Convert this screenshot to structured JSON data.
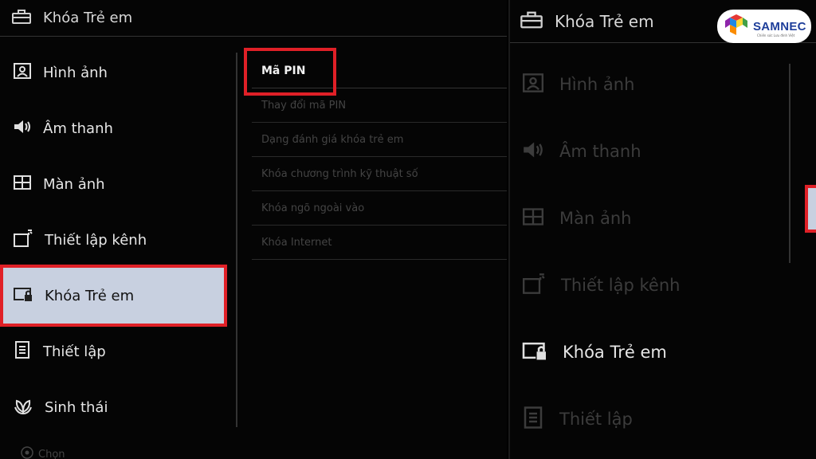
{
  "left_panel": {
    "header": {
      "title": "Khóa Trẻ em",
      "icon": "toolbox-icon"
    },
    "menu": [
      {
        "label": "Hình ảnh",
        "icon": "picture-icon",
        "state": "normal"
      },
      {
        "label": "Âm thanh",
        "icon": "speaker-icon",
        "state": "normal"
      },
      {
        "label": "Màn ảnh",
        "icon": "screen-icon",
        "state": "normal"
      },
      {
        "label": "Thiết lập kênh",
        "icon": "channel-setup-icon",
        "state": "normal"
      },
      {
        "label": "Khóa Trẻ em",
        "icon": "parental-lock-icon",
        "state": "selected"
      },
      {
        "label": "Thiết lập",
        "icon": "settings-icon",
        "state": "normal"
      },
      {
        "label": "Sinh thái",
        "icon": "eco-icon",
        "state": "normal"
      }
    ],
    "submenu": [
      "Mã PIN",
      "Thay đổi mã PIN",
      "Dạng đánh giá khóa trẻ em",
      "Khóa chương trình kỹ thuật số",
      "Khóa ngõ ngoài vào",
      "Khóa Internet"
    ],
    "footer": {
      "icon": "dpad-icon",
      "label": "Chọn"
    }
  },
  "right_panel": {
    "header": {
      "title": "Khóa Trẻ em",
      "icon": "toolbox-icon"
    },
    "menu": [
      {
        "label": "Hình ảnh",
        "icon": "picture-icon",
        "state": "dim"
      },
      {
        "label": "Âm thanh",
        "icon": "speaker-icon",
        "state": "dim"
      },
      {
        "label": "Màn ảnh",
        "icon": "screen-icon",
        "state": "dim"
      },
      {
        "label": "Thiết lập kênh",
        "icon": "channel-setup-icon",
        "state": "dim"
      },
      {
        "label": "Khóa Trẻ em",
        "icon": "parental-lock-icon",
        "state": "active"
      },
      {
        "label": "Thiết lập",
        "icon": "settings-icon",
        "state": "dim"
      }
    ]
  },
  "logo": {
    "brand": "SAMNEC",
    "tagline": "Chiến sức Lưu đình Việt"
  },
  "colors": {
    "highlight_red": "#e02027",
    "selection_bg": "#c8d0e0",
    "brand_blue": "#1e3e9a"
  }
}
